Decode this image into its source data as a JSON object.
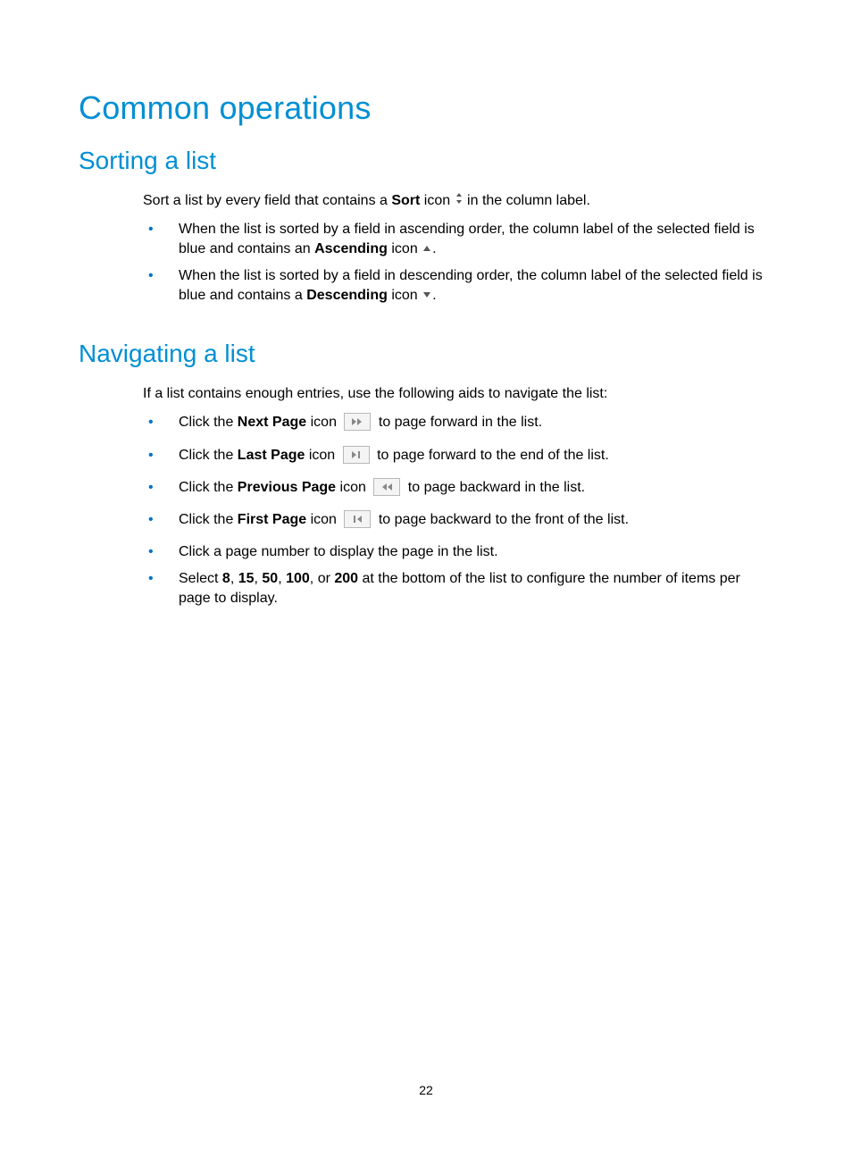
{
  "title": "Common operations",
  "sections": {
    "sorting": {
      "heading": "Sorting a list",
      "intro_pre": "Sort a list by every field that contains a ",
      "intro_bold": "Sort",
      "intro_mid": " icon ",
      "intro_post": " in the column label.",
      "bullets": [
        {
          "t1": "When the list is sorted by a field in ascending order, the column label of the selected field is blue and contains an ",
          "b": "Ascending",
          "t2": " icon ",
          "t3": "."
        },
        {
          "t1": "When the list is sorted by a field in descending order, the column label of the selected field is blue and contains a ",
          "b": "Descending",
          "t2": " icon ",
          "t3": "."
        }
      ]
    },
    "navigating": {
      "heading": "Navigating a list",
      "intro": "If a list contains enough entries, use the following aids to navigate the list:",
      "bullets": [
        {
          "pre": "Click the ",
          "bold": "Next Page",
          "mid": " icon ",
          "post": " to page forward in the list."
        },
        {
          "pre": "Click the ",
          "bold": "Last Page",
          "mid": " icon ",
          "post": " to page forward to the end of the list."
        },
        {
          "pre": "Click the ",
          "bold": "Previous Page",
          "mid": " icon ",
          "post": " to page backward in the list."
        },
        {
          "pre": "Click the ",
          "bold": "First Page",
          "mid": " icon ",
          "post": " to page backward to the front of the list."
        }
      ],
      "bullet_plain": "Click a page number to display the page in the list.",
      "bullet_sizes": {
        "pre": "Select ",
        "n1": "8",
        "c1": ", ",
        "n2": "15",
        "c2": ", ",
        "n3": "50",
        "c3": ", ",
        "n4": "100",
        "c4": ", or ",
        "n5": "200",
        "post": " at the bottom of the list to configure the number of items per page to display."
      }
    }
  },
  "page_number": "22"
}
